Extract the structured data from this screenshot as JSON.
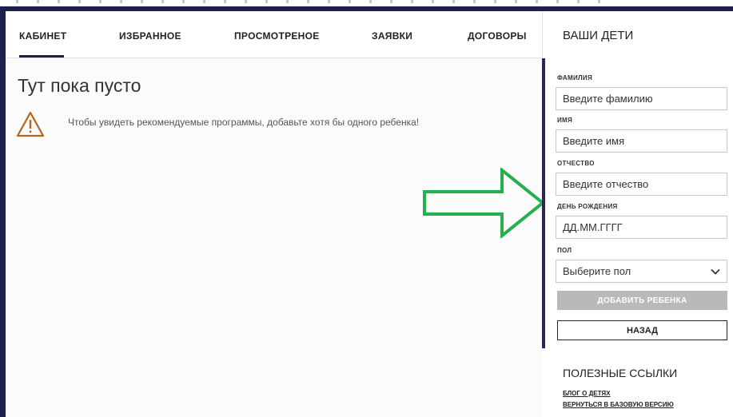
{
  "nav": {
    "tabs": [
      {
        "label": "КАБИНЕТ",
        "active": true
      },
      {
        "label": "ИЗБРАННОЕ"
      },
      {
        "label": "ПРОСМОТРЕНОЕ"
      },
      {
        "label": "ЗАЯВКИ"
      },
      {
        "label": "ДОГОВОРЫ"
      }
    ]
  },
  "main": {
    "empty_title": "Тут пока пусто",
    "warning_text": "Чтобы увидеть рекомендуемые программы, добавьте хотя бы одного ребенка!"
  },
  "sidebar": {
    "title": "ВАШИ ДЕТИ",
    "form": {
      "last_name": {
        "label": "ФАМИЛИЯ",
        "placeholder": "Введите фамилию"
      },
      "first_name": {
        "label": "ИМЯ",
        "placeholder": "Введите имя"
      },
      "patronymic": {
        "label": "ОТЧЕСТВО",
        "placeholder": "Введите отчество"
      },
      "birthday": {
        "label": "ДЕНЬ РОЖДЕНИЯ",
        "placeholder": "ДД.ММ.ГГГГ"
      },
      "gender": {
        "label": "ПОЛ",
        "selected": "Выберите пол"
      },
      "add_button": "ДОБАВИТЬ РЕБЕНКА",
      "back_button": "НАЗАД"
    },
    "links": {
      "title": "ПОЛЕЗНЫЕ ССЫЛКИ",
      "items": [
        "БЛОГ О ДЕТЯХ",
        "ВЕРНУТЬСЯ В БАЗОВУЮ ВЕРСИЮ"
      ]
    }
  },
  "icons": {
    "warning": "warning-triangle-icon",
    "arrow": "arrow-right-icon",
    "chevron": "chevron-down-icon"
  },
  "colors": {
    "brand_dark": "#1e1f4b",
    "warning": "#b5651d",
    "arrow": "#22b14c",
    "disabled_button": "#b9b9b9"
  }
}
